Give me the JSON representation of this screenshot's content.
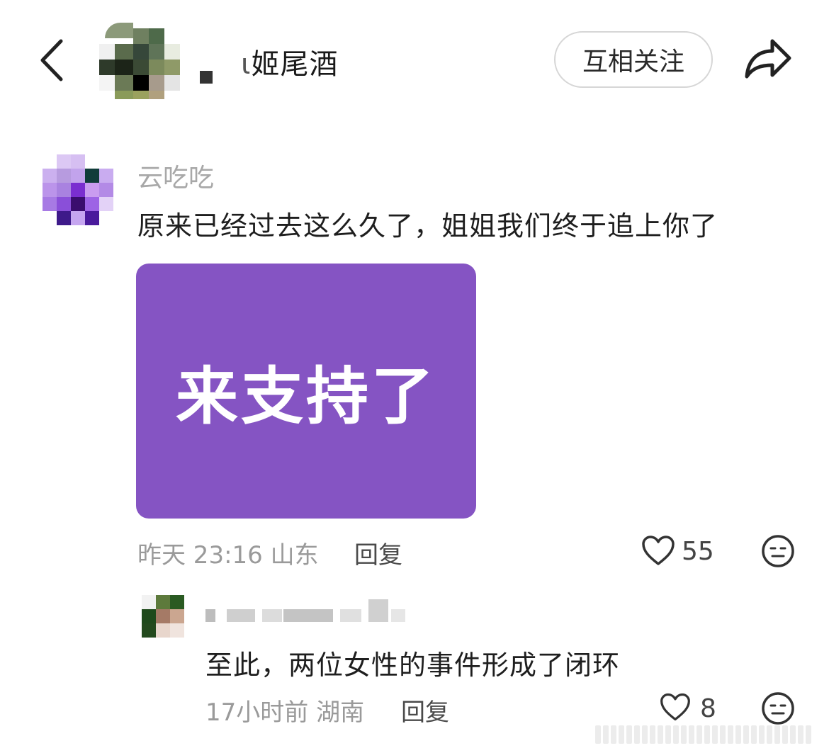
{
  "header": {
    "title": "姬尾酒",
    "title_prefix_fragment": "ι",
    "follow_label": "互相关注"
  },
  "comment": {
    "username": "云吃吃",
    "text": "原来已经过去这么久了，姐姐我们终于追上你了",
    "sticker_text": "来支持了",
    "sticker_color": "#8554c3",
    "meta": "昨天 23:16 山东",
    "reply_label": "回复",
    "like_count": "55"
  },
  "reply": {
    "text": "至此，两位女性的事件形成了闭环",
    "meta": "17小时前 湖南",
    "reply_label": "回复",
    "like_count": "8"
  },
  "icons": {
    "back": "chevron-left-icon",
    "share": "share-icon",
    "like": "heart-icon",
    "emoji": "neutral-face-icon"
  }
}
